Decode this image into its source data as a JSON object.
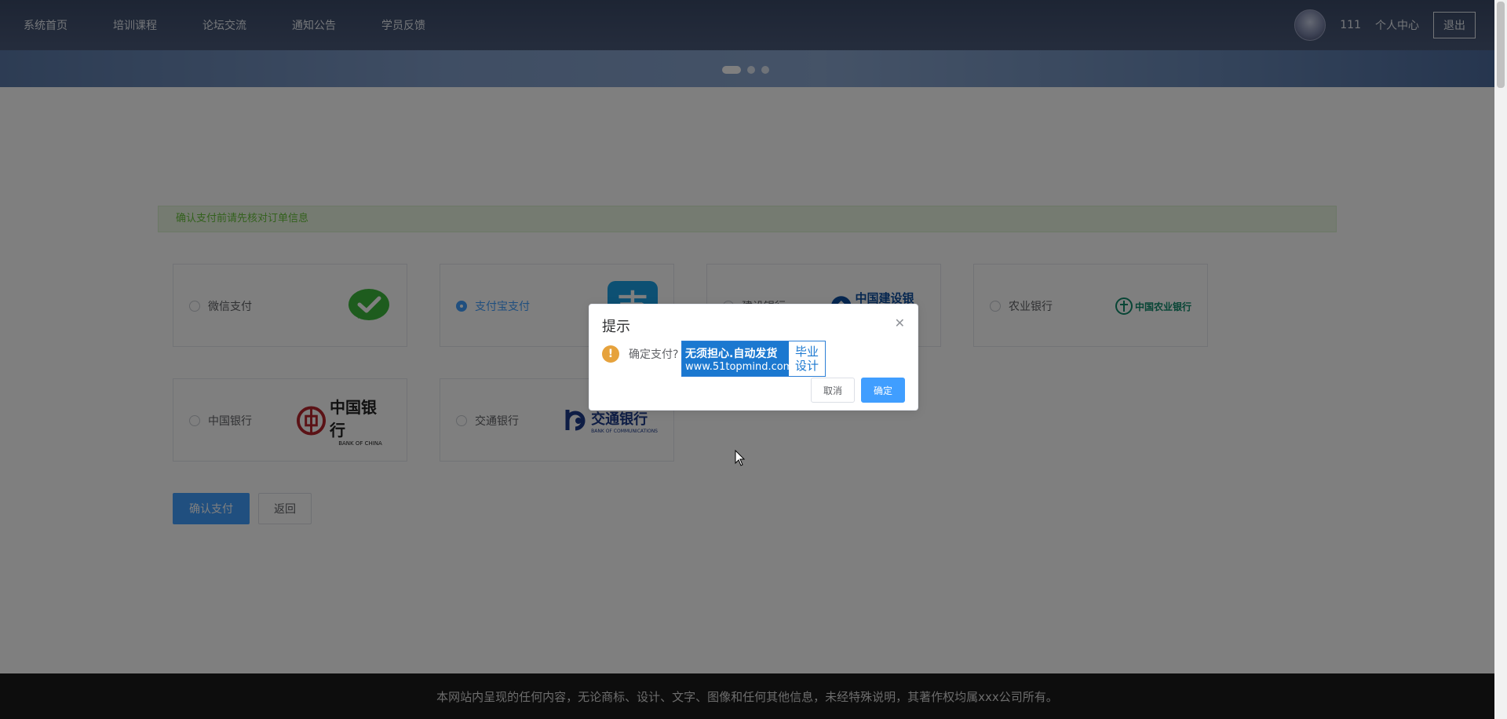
{
  "nav": {
    "items": [
      {
        "label": "系统首页"
      },
      {
        "label": "培训课程"
      },
      {
        "label": "论坛交流"
      },
      {
        "label": "通知公告"
      },
      {
        "label": "学员反馈"
      }
    ],
    "user": "111",
    "profile": "个人中心",
    "logout": "退出"
  },
  "alert": {
    "text": "确认支付前请先核对订单信息"
  },
  "payments": [
    {
      "label": "微信支付",
      "icon": "wechat-pay-icon",
      "checked": false
    },
    {
      "label": "支付宝支付",
      "icon": "alipay-icon",
      "checked": true
    },
    {
      "label": "建设银行",
      "icon": "ccb-logo",
      "logo_text": "中国建设银行",
      "checked": false
    },
    {
      "label": "农业银行",
      "icon": "abc-logo",
      "logo_text": "中国农业银行",
      "checked": false
    },
    {
      "label": "中国银行",
      "icon": "boc-logo",
      "logo_text": "中国银行",
      "logo_sub": "BANK OF CHINA",
      "checked": false
    },
    {
      "label": "交通银行",
      "icon": "bocom-logo",
      "logo_text": "交通银行",
      "logo_sub": "BANK OF COMMUNICATIONS",
      "checked": false
    }
  ],
  "actions": {
    "confirm": "确认支付",
    "back": "返回"
  },
  "footer": {
    "text": "本网站内呈现的任何内容，无论商标、设计、文字、图像和任何其他信息，未经特殊说明，其著作权均属xxx公司所有。"
  },
  "dialog": {
    "title": "提示",
    "message": "确定支付?",
    "cancel": "取消",
    "confirm": "确定"
  },
  "stamp": {
    "line1": "无须担心.自动发货",
    "line2": "www.51topmind.com",
    "right1": "毕业",
    "right2": "设计"
  },
  "colors": {
    "primary": "#409eff",
    "success": "#67c23a",
    "warning": "#e6a23c",
    "nav_bg": "#3b4a68"
  }
}
